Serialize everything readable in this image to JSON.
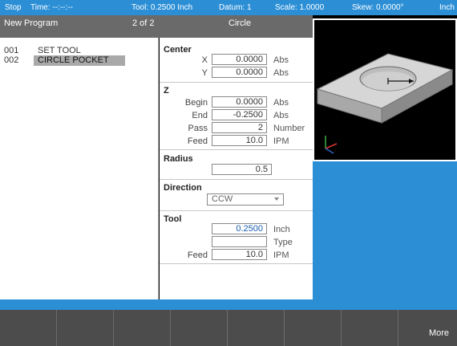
{
  "status": {
    "state": "Stop",
    "time": "Time: --:--:--",
    "tool": "Tool: 0.2500 Inch",
    "datum": "Datum: 1",
    "scale": "Scale: 1.0000",
    "skew": "Skew: 0.0000°",
    "units": "Inch"
  },
  "header": {
    "program": "New Program",
    "position": "2 of 2",
    "step": "Circle"
  },
  "program_list": [
    {
      "num": "001",
      "name": "SET TOOL"
    },
    {
      "num": "002",
      "name": "CIRCLE POCKET"
    }
  ],
  "form": {
    "center": {
      "title": "Center",
      "x_label": "X",
      "x_value": "0.0000",
      "x_unit": "Abs",
      "y_label": "Y",
      "y_value": "0.0000",
      "y_unit": "Abs"
    },
    "z": {
      "title": "Z",
      "begin_label": "Begin",
      "begin_value": "0.0000",
      "begin_unit": "Abs",
      "end_label": "End",
      "end_value": "-0.2500",
      "end_unit": "Abs",
      "pass_label": "Pass",
      "pass_value": "2",
      "pass_unit": "Number",
      "feed_label": "Feed",
      "feed_value": "10.0",
      "feed_unit": "IPM"
    },
    "radius": {
      "title": "Radius",
      "value": "0.5"
    },
    "direction": {
      "title": "Direction",
      "value": "CCW"
    },
    "tool": {
      "title": "Tool",
      "diameter_value": "0.2500",
      "diameter_unit": "Inch",
      "type_value": "",
      "type_unit": "Type",
      "feed_label": "Feed",
      "feed_value": "10.0",
      "feed_unit": "IPM"
    }
  },
  "softkeys": [
    "",
    "",
    "",
    "",
    "",
    "",
    "",
    "More"
  ],
  "colors": {
    "status_blue": "#2c8fd6",
    "header_gray": "#6a6a6a",
    "softkey_gray": "#4c4c4c",
    "selection_gray": "#a9a9a9"
  }
}
